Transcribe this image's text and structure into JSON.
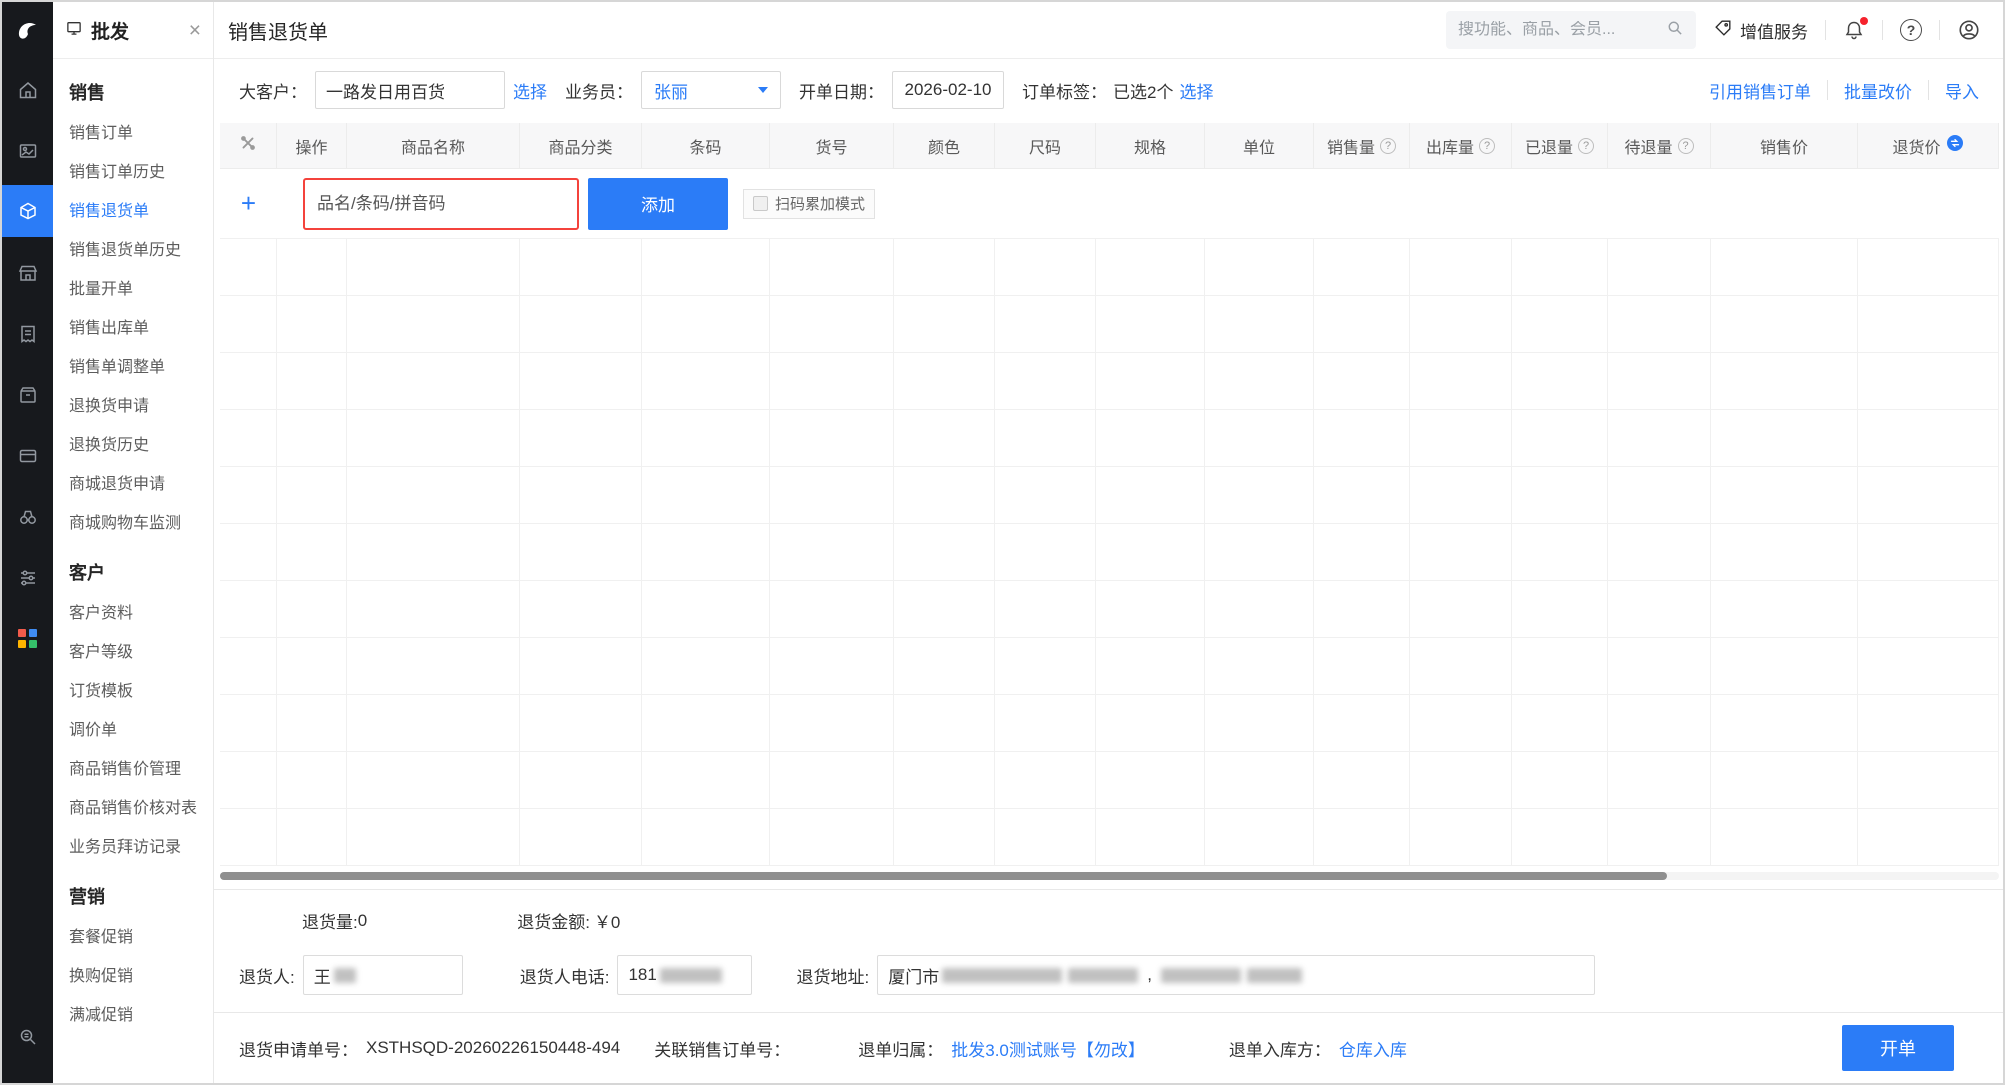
{
  "rail": {
    "icons": [
      "app-logo",
      "home-icon",
      "gallery-icon",
      "sales-icon",
      "store-icon",
      "receipt-icon",
      "package-icon",
      "card-icon",
      "binoculars-icon",
      "sliders-icon",
      "apps-icon",
      "search-list-icon"
    ],
    "accent_color": "#2b7cf7",
    "apps_colors": [
      "#f25b4b",
      "#3f8cf3",
      "#ffb400",
      "#35c06a"
    ]
  },
  "sidebar": {
    "title": "批发",
    "sections": [
      {
        "title": "销售",
        "items": [
          "销售订单",
          "销售订单历史",
          "销售退货单",
          "销售退货单历史",
          "批量开单",
          "销售出库单",
          "销售单调整单",
          "退换货申请",
          "退换货历史",
          "商城退货申请",
          "商城购物车监测"
        ],
        "active_item": "销售退货单"
      },
      {
        "title": "客户",
        "items": [
          "客户资料",
          "客户等级",
          "订货模板",
          "调价单",
          "商品销售价管理",
          "商品销售价核对表",
          "业务员拜访记录"
        ]
      },
      {
        "title": "营销",
        "items": [
          "套餐促销",
          "换购促销",
          "满减促销"
        ]
      }
    ]
  },
  "header": {
    "title": "销售退货单",
    "search_placeholder": "搜功能、商品、会员...",
    "value_added_label": "增值服务"
  },
  "toolbar": {
    "customer_label": "大客户：",
    "customer_value": "一路发日用百货",
    "customer_select": "选择",
    "salesman_label": "业务员：",
    "salesman_value": "张丽",
    "date_label": "开单日期：",
    "date_value": "2026-02-10",
    "tag_label": "订单标签：",
    "tag_selected": "已选2个",
    "tag_select": "选择",
    "link_quote": "引用销售订单",
    "link_batch_price": "批量改价",
    "link_import": "导入"
  },
  "table": {
    "cols": [
      "操作",
      "商品名称",
      "商品分类",
      "条码",
      "货号",
      "颜色",
      "尺码",
      "规格",
      "单位",
      "销售量",
      "出库量",
      "已退量",
      "待退量",
      "销售价",
      "退货价"
    ],
    "add_placeholder": "品名/条码/拼音码",
    "add_button": "添加",
    "scan_mode": "扫码累加模式"
  },
  "summary": {
    "qty_label": "退货量:",
    "qty_value": "0",
    "amount_label": "退货金额:",
    "amount_value": "￥0",
    "returner_label": "退货人:",
    "returner_prefix": "王",
    "phone_label": "退货人电话:",
    "phone_prefix": "181",
    "address_label": "退货地址:",
    "address_prefix": "厦门市"
  },
  "footer": {
    "apply_no_label": "退货申请单号：",
    "apply_no": "XSTHSQD-20260226150448-494",
    "related_label": "关联销售订单号：",
    "belong_label": "退单归属：",
    "belong_value": "批发3.0测试账号【勿改】",
    "warehouse_label": "退单入库方：",
    "warehouse_value": "仓库入库",
    "submit": "开单"
  }
}
